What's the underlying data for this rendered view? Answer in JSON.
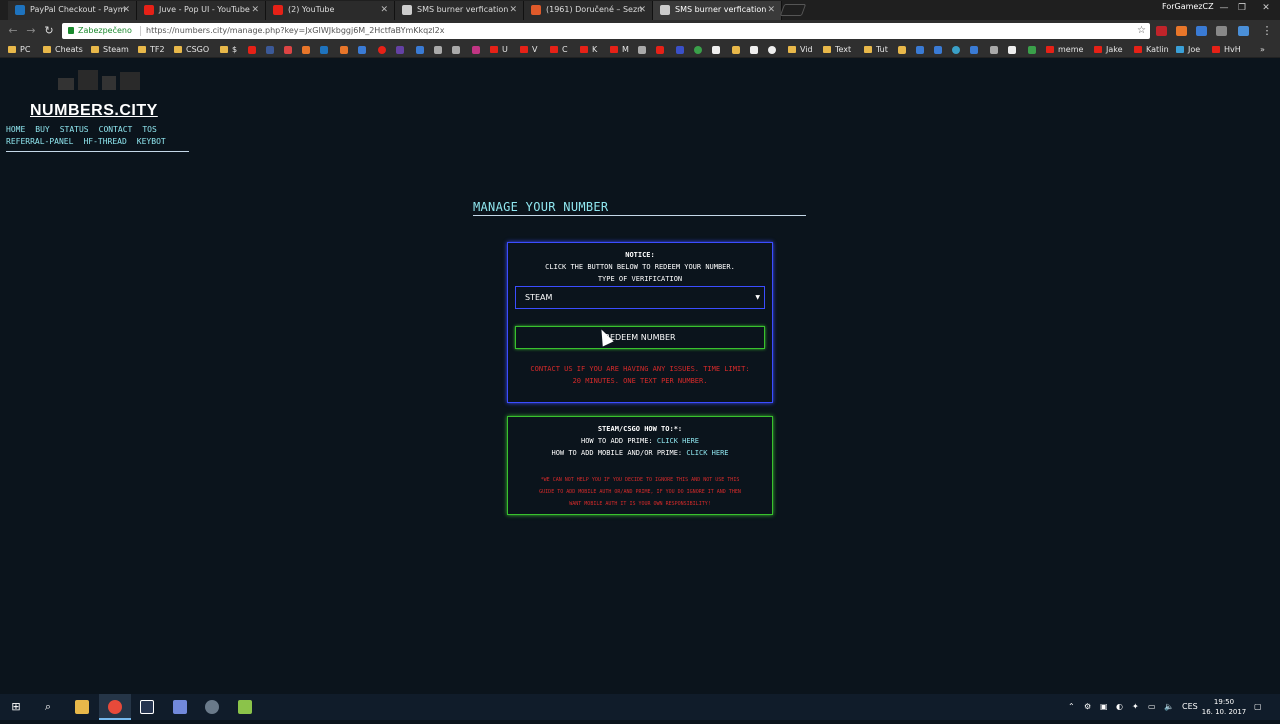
{
  "tabs": [
    {
      "title": "PayPal Checkout - Paym",
      "color": "#1e73be"
    },
    {
      "title": "Juve - Pop UI - YouTube",
      "color": "#e62117"
    },
    {
      "title": "(2) YouTube",
      "color": "#e62117"
    },
    {
      "title": "SMS burner verfication",
      "color": "#cccccc"
    },
    {
      "title": "(1961) Doručené – Sezn",
      "color": "#e05a2a"
    },
    {
      "title": "SMS burner verfication",
      "color": "#cccccc"
    }
  ],
  "profile": "ForGamezCZ",
  "address": {
    "secure": "Zabezpečeno",
    "url": "https://numbers.city/manage.php?key=JxGIWJkbggj6M_2HctfaBYmKkqzl2x"
  },
  "bookmarks": [
    "PC",
    "Cheats",
    "Steam",
    "TF2",
    "CSGO",
    "$",
    "U",
    "V",
    "C",
    "K",
    "M",
    "Vid",
    "Text",
    "Tut",
    "meme",
    "Jake",
    "Katlin",
    "Joe",
    "HvH"
  ],
  "site": {
    "logo": "NUMBERS.CITY",
    "nav_line1": [
      "HOME",
      "BUY",
      "STATUS",
      "CONTACT",
      "TOS"
    ],
    "nav_line2": [
      "REFERRAL-PANEL",
      "HF-THREAD",
      "KEYBOT"
    ]
  },
  "manage": {
    "title": "MANAGE YOUR NUMBER",
    "notice_label": "NOTICE:",
    "notice_text": "CLICK THE BUTTON BELOW TO REDEEM YOUR NUMBER.",
    "type_label": "TYPE OF VERIFICATION",
    "select_value": "STEAM",
    "redeem_button": "REDEEM NUMBER",
    "contact_line1": "CONTACT US IF YOU ARE HAVING ANY ISSUES. TIME LIMIT:",
    "contact_line2": "20 MINUTES. ONE TEXT PER NUMBER."
  },
  "howto": {
    "title": "STEAM/CSGO HOW TO:*:",
    "add_prime": "HOW TO ADD PRIME:",
    "add_mobile": "HOW TO ADD MOBILE AND/OR PRIME:",
    "link": "CLICK HERE",
    "warn1": "*WE CAN NOT HELP YOU IF YOU DECIDE TO IGNORE THIS AND NOT USE THIS",
    "warn2": "GUIDE TO ADD MOBILE AUTH OR/AND PRIME, IF YOU DO IGNORE IT AND THEN",
    "warn3": "WANT MOBILE AUTH IT IS YOUR OWN RESPONSIBILITY!"
  },
  "taskbar": {
    "lang": "CES",
    "time": "19:50",
    "date": "16. 10. 2017"
  }
}
